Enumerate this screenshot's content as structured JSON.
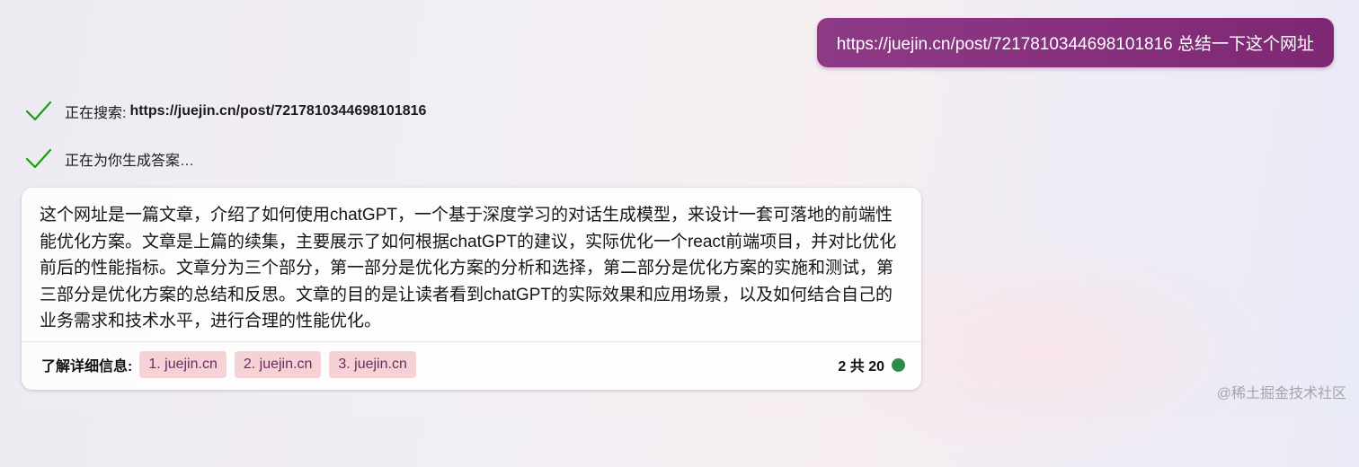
{
  "user_message": {
    "text": "https://juejin.cn/post/7217810344698101816 总结一下这个网址"
  },
  "progress": [
    {
      "icon": "check-icon",
      "label": "正在搜索:",
      "value": "https://juejin.cn/post/7217810344698101816"
    },
    {
      "icon": "check-icon",
      "label": "正在为你生成答案…"
    }
  ],
  "answer": {
    "text": "这个网址是一篇文章，介绍了如何使用chatGPT，一个基于深度学习的对话生成模型，来设计一套可落地的前端性能优化方案。文章是上篇的续集，主要展示了如何根据chatGPT的建议，实际优化一个react前端项目，并对比优化前后的性能指标。文章分为三个部分，第一部分是优化方案的分析和选择，第二部分是优化方案的实施和测试，第三部分是优化方案的总结和反思。文章的目的是让读者看到chatGPT的实际效果和应用场景，以及如何结合自己的业务需求和技术水平，进行合理的性能优化。",
    "learn_more_label": "了解详细信息:",
    "sources": [
      "1. juejin.cn",
      "2. juejin.cn",
      "3. juejin.cn"
    ],
    "turn_counter": "2 共 20"
  },
  "watermark": "@稀土掘金技术社区",
  "colors": {
    "user_bubble": "#862f7d",
    "check": "#13a10e",
    "source_chip_bg": "#f4d2d6",
    "source_chip_text": "#6e2a60",
    "status_dot": "#2e8b45"
  }
}
